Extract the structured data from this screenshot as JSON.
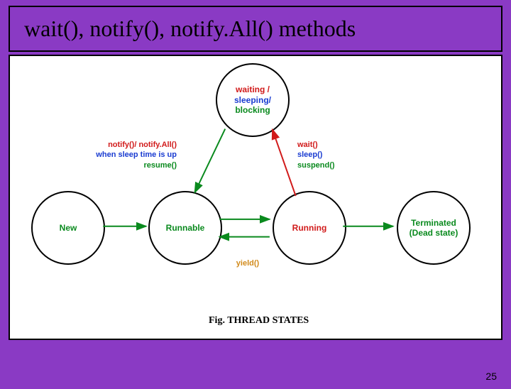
{
  "title": "wait(), notify(), notify.All() methods",
  "states": {
    "new": "New",
    "runnable": "Runnable",
    "running": "Running",
    "terminated_l1": "Terminated",
    "terminated_l2": "(Dead state)",
    "wsb_waiting": "waiting /",
    "wsb_sleeping": "sleeping/",
    "wsb_blocking": "blocking"
  },
  "transitions": {
    "to_runnable_l1": "notify()/ notify.All()",
    "to_runnable_l2": "when sleep time is up",
    "to_runnable_l3": "resume()",
    "to_wsb_l1": "wait()",
    "to_wsb_l2": "sleep()",
    "to_wsb_l3": "suspend()",
    "yield": "yield()"
  },
  "caption": "Fig. THREAD STATES",
  "page": "25",
  "colors": {
    "red": "#d11a1a",
    "blue": "#1a3cd1",
    "green": "#0a8a1e",
    "orange": "#d18a1a"
  }
}
